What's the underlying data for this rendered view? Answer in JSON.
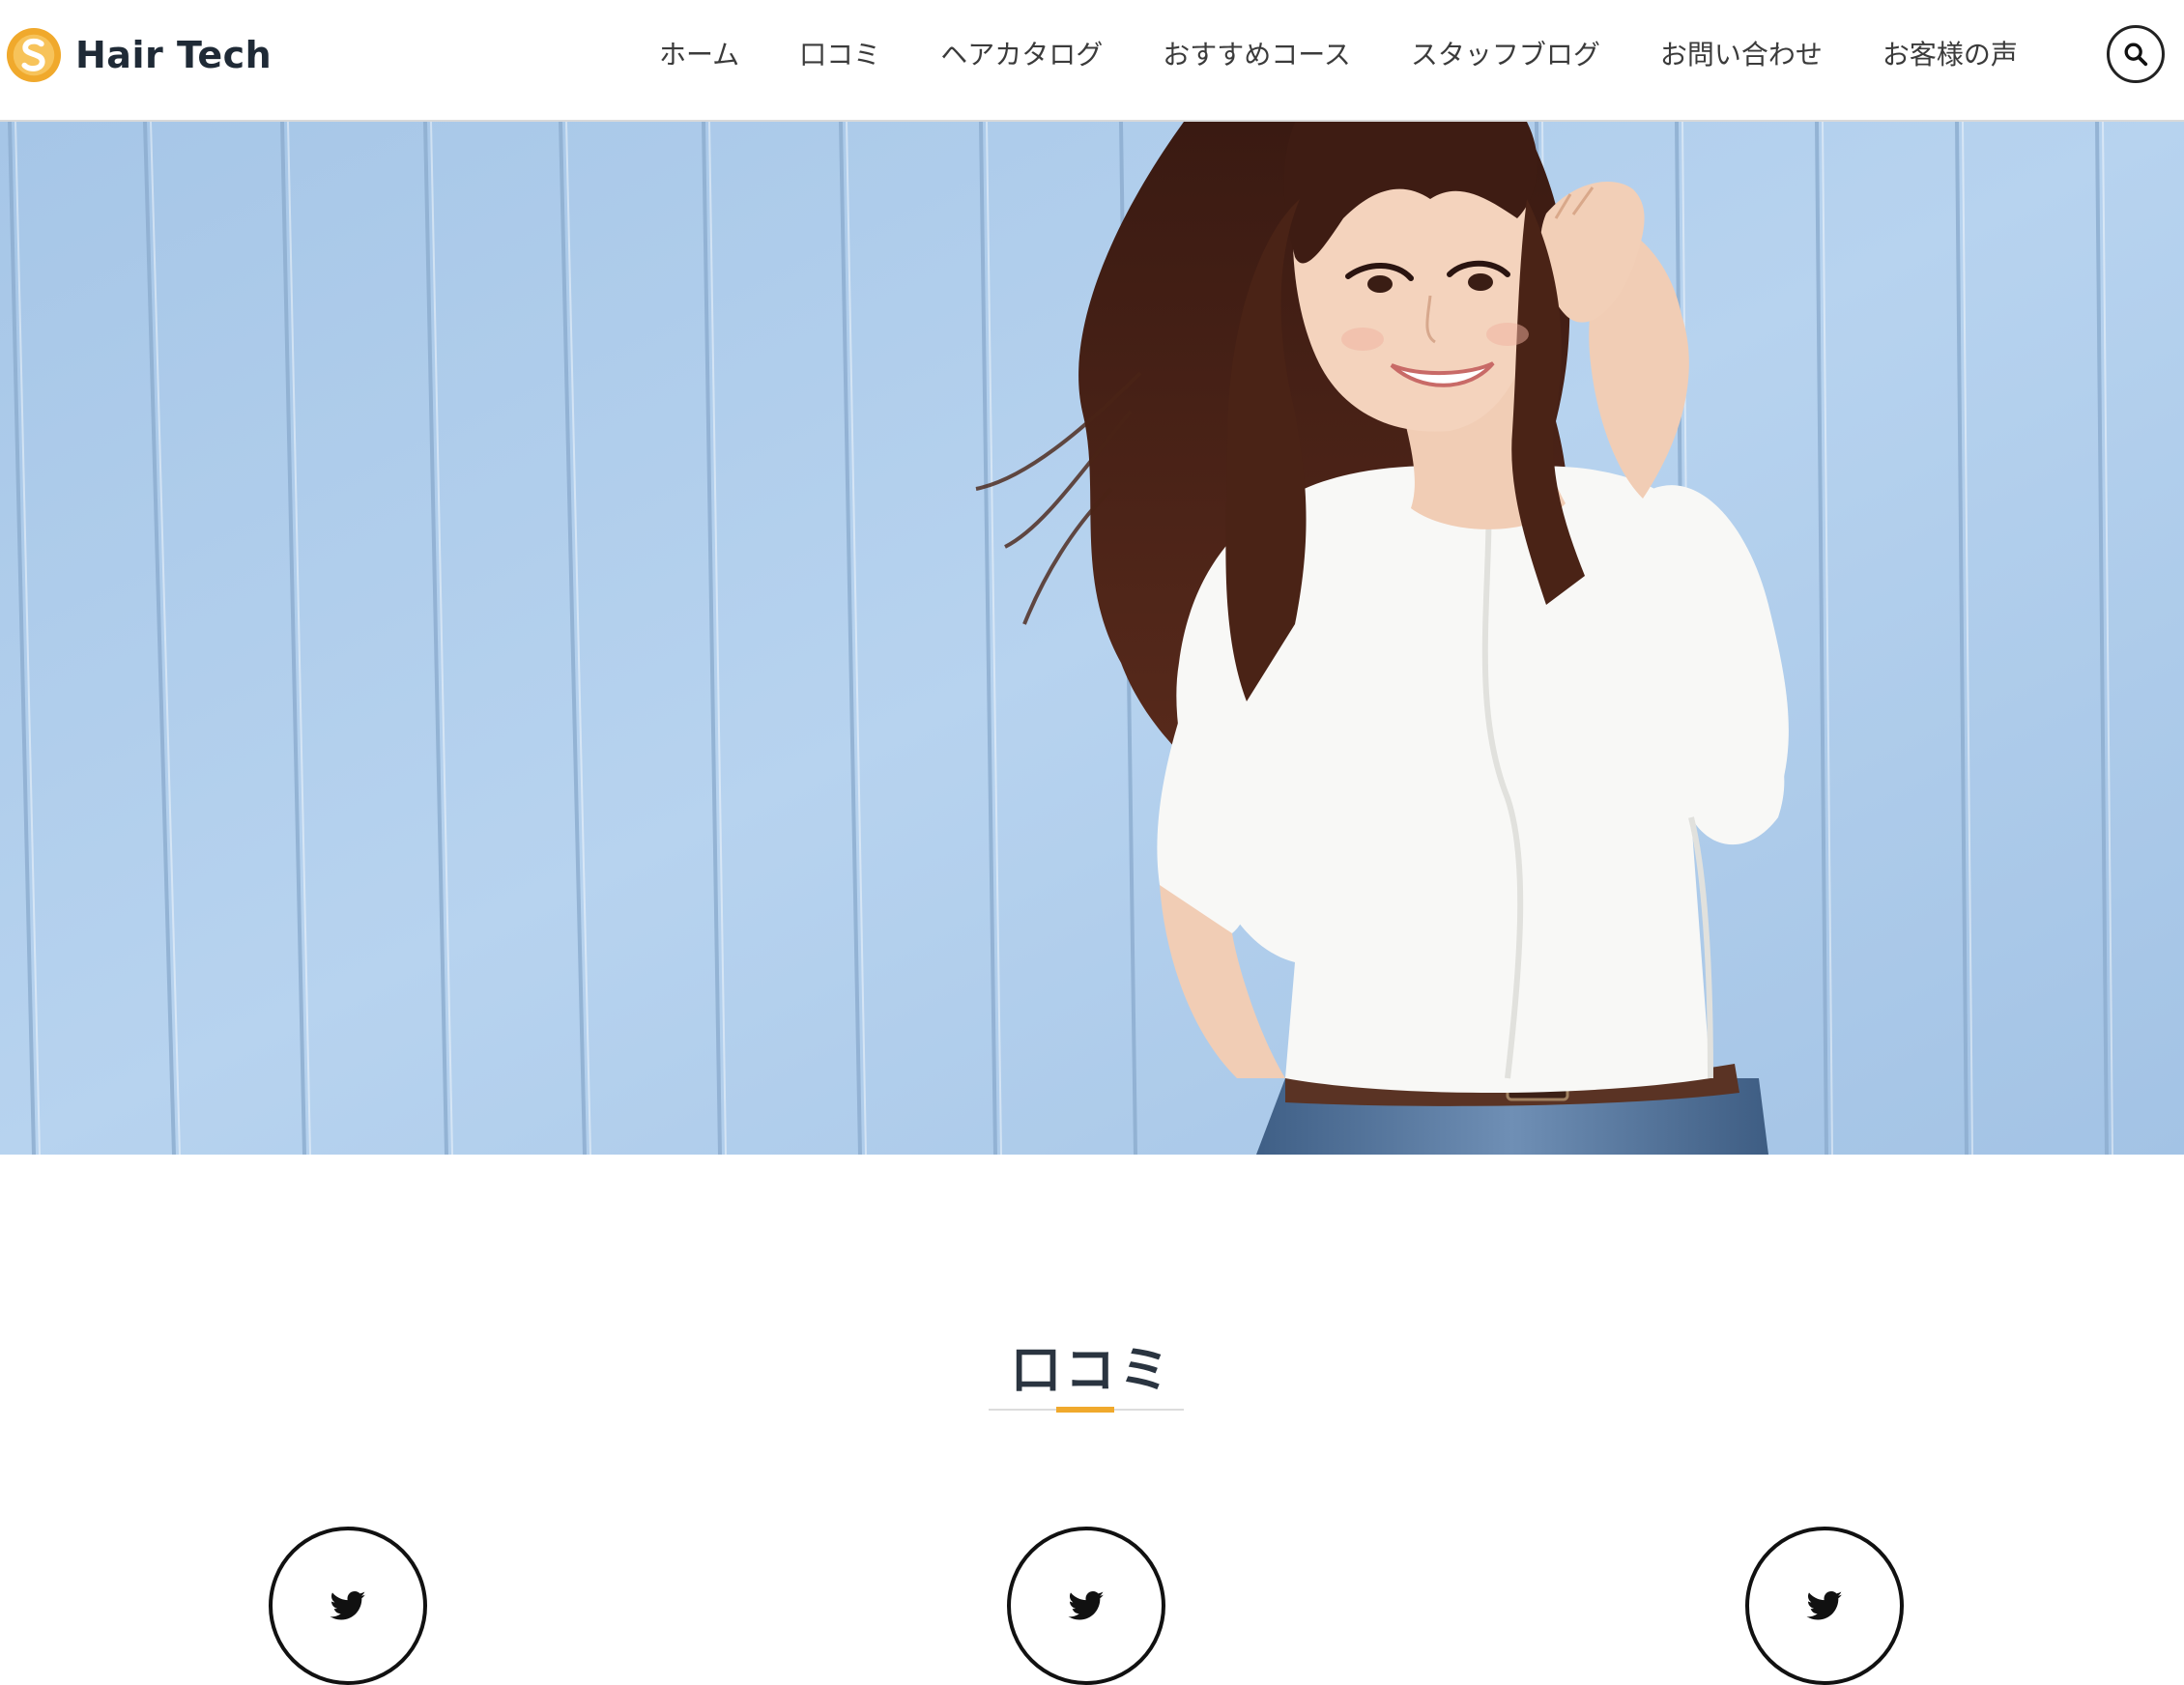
{
  "site": {
    "brand": "Hair Tech",
    "brand_color": "#f0a92c"
  },
  "nav": {
    "items": [
      "ホーム",
      "口コミ",
      "ヘアカタログ",
      "おすすめコース",
      "スタッフブログ",
      "お問い合わせ",
      "お客様の声"
    ],
    "search_icon": "search-icon"
  },
  "hero": {
    "image": "woman-in-white-shirt-against-blue-wooden-wall"
  },
  "section": {
    "title": "口コミ",
    "accent_color": "#f0a92c",
    "cards": [
      {
        "icon": "twitter-icon"
      },
      {
        "icon": "twitter-icon"
      },
      {
        "icon": "twitter-icon"
      }
    ]
  }
}
